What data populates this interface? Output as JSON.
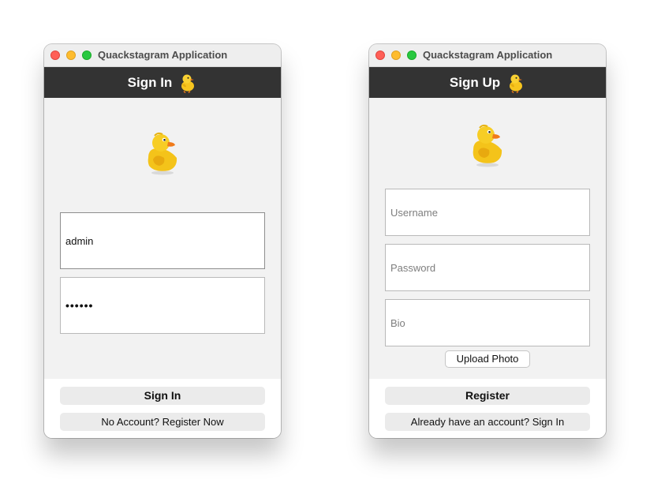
{
  "signin_window": {
    "title": "Quackstagram Application",
    "header_title": "Sign In",
    "username_value": "admin",
    "password_masked": "••••••",
    "primary_button": "Sign In",
    "secondary_button": "No Account? Register Now"
  },
  "signup_window": {
    "title": "Quackstagram Application",
    "header_title": "Sign Up",
    "username_placeholder": "Username",
    "password_placeholder": "Password",
    "bio_placeholder": "Bio",
    "upload_button": "Upload Photo",
    "primary_button": "Register",
    "secondary_button": "Already have an account? Sign In"
  },
  "colors": {
    "header_bg": "#333333",
    "close": "#ff5f57",
    "minimize": "#febc2e",
    "maximize": "#28c840",
    "duck_yellow": "#f5c518",
    "duck_beak": "#f07a1a"
  },
  "icons": [
    "chick-icon",
    "duck-logo-icon"
  ]
}
